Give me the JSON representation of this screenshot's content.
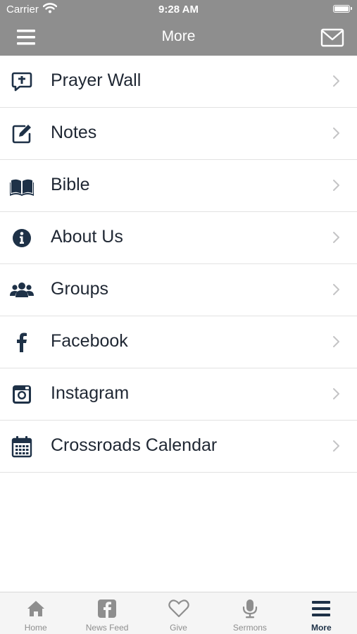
{
  "status_bar": {
    "carrier": "Carrier",
    "time": "9:28 AM"
  },
  "header": {
    "title": "More",
    "menu_icon": "hamburger-menu-icon",
    "mail_icon": "envelope-icon"
  },
  "colors": {
    "header_bg": "#8e8e8e",
    "icon_navy": "#1e3147",
    "tab_inactive": "#8e8e8e"
  },
  "menu": {
    "items": [
      {
        "label": "Prayer Wall",
        "icon": "prayer-bubble-icon"
      },
      {
        "label": "Notes",
        "icon": "edit-note-icon"
      },
      {
        "label": "Bible",
        "icon": "open-book-icon"
      },
      {
        "label": "About Us",
        "icon": "info-circle-icon"
      },
      {
        "label": "Groups",
        "icon": "users-group-icon"
      },
      {
        "label": "Facebook",
        "icon": "facebook-icon"
      },
      {
        "label": "Instagram",
        "icon": "instagram-icon"
      },
      {
        "label": "Crossroads Calendar",
        "icon": "calendar-icon"
      }
    ]
  },
  "tabs": [
    {
      "label": "Home",
      "icon": "home-icon",
      "active": false
    },
    {
      "label": "News Feed",
      "icon": "facebook-square-icon",
      "active": false
    },
    {
      "label": "Give",
      "icon": "heart-icon",
      "active": false
    },
    {
      "label": "Sermons",
      "icon": "microphone-icon",
      "active": false
    },
    {
      "label": "More",
      "icon": "hamburger-menu-icon",
      "active": true
    }
  ]
}
